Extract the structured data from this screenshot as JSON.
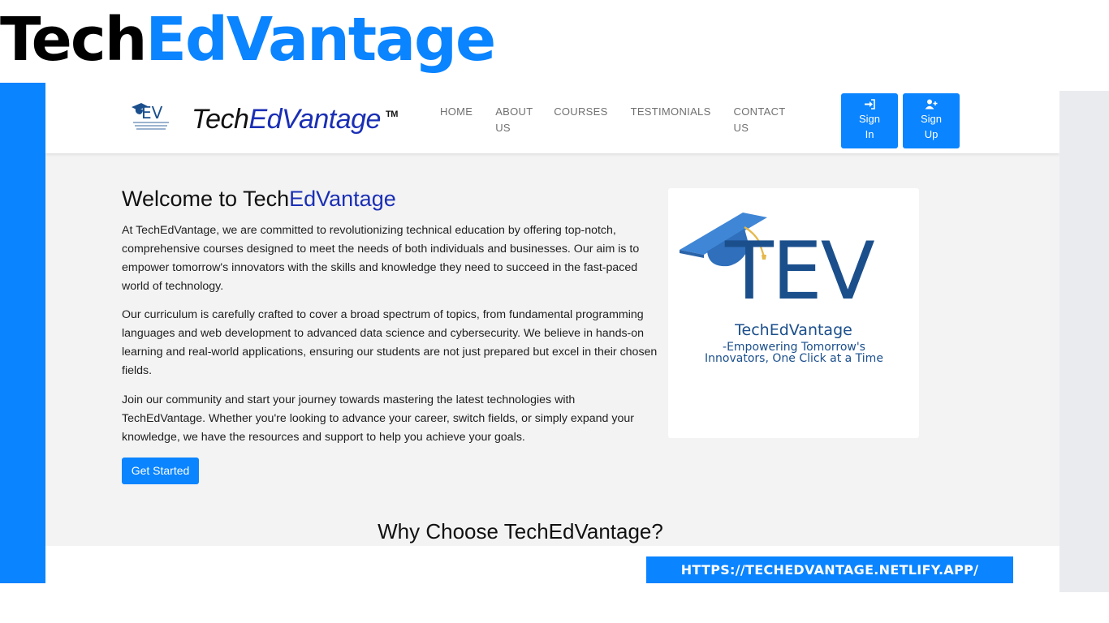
{
  "slide_title": {
    "part1": "Tech",
    "part2": "EdVantage"
  },
  "navbar": {
    "brand_part1": "Tech",
    "brand_part2": "EdVantage",
    "brand_tm": "TM",
    "links": [
      "HOME",
      "ABOUT US",
      "COURSES",
      "TESTIMONIALS",
      "CONTACT US"
    ],
    "signin_label": "Sign In",
    "signup_label": "Sign Up"
  },
  "hero": {
    "title_part1": "Welcome to Tech",
    "title_part2": "EdVantage",
    "paragraphs": [
      "At TechEdVantage, we are committed to revolutionizing technical education by offering top-notch, comprehensive courses designed to meet the needs of both individuals and businesses. Our aim is to empower tomorrow's innovators with the skills and knowledge they need to succeed in the fast-paced world of technology.",
      "Our curriculum is carefully crafted to cover a broad spectrum of topics, from fundamental programming languages and web development to advanced data science and cybersecurity. We believe in hands-on learning and real-world applications, ensuring our students are not just prepared but excel in their chosen fields.",
      "Join our community and start your journey towards mastering the latest technologies with TechEdVantage. Whether you're looking to advance your career, switch fields, or simply expand your knowledge, we have the resources and support to help you achieve your goals."
    ],
    "cta_label": "Get Started"
  },
  "logo_card": {
    "monogram": "TEV",
    "name": "TechEdVantage",
    "tagline": "-Empowering Tomorrow's Innovators, One Click at a Time"
  },
  "section_heading": "Why Choose TechEdVantage?",
  "url_banner": "HTTPS://TECHEDVANTAGE.NETLIFY.APP/",
  "colors": {
    "accent": "#0a84ff",
    "brand_dark_blue": "#1a2fb5",
    "logo_blue": "#1b4f8c"
  },
  "icons": {
    "signin": "sign-in-icon",
    "signup": "user-plus-icon",
    "logo": "graduation-cap-icon"
  }
}
